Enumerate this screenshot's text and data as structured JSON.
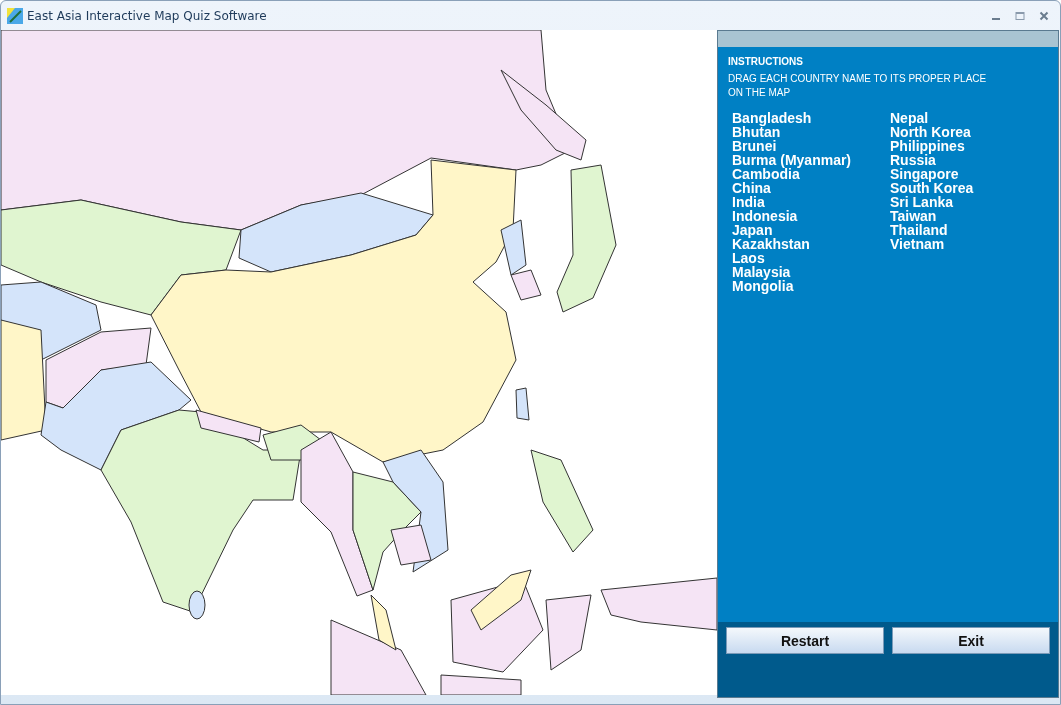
{
  "window": {
    "title": "East Asia Interactive Map Quiz Software"
  },
  "panel": {
    "heading": "INSTRUCTIONS",
    "instruction": "DRAG EACH COUNTRY NAME TO ITS PROPER PLACE ON THE MAP"
  },
  "country_columns": [
    [
      "Bangladesh",
      "Bhutan",
      "Brunei",
      "Burma (Myanmar)",
      "Cambodia",
      "China",
      "India",
      "Indonesia",
      "Japan",
      "Kazakhstan",
      "Laos",
      "Malaysia",
      "Mongolia"
    ],
    [
      "Nepal",
      "North Korea",
      "Philippines",
      "Russia",
      "Singapore",
      "South Korea",
      "Sri Lanka",
      "Taiwan",
      "Thailand",
      "Vietnam"
    ]
  ],
  "buttons": [
    "Restart",
    "Exit"
  ]
}
